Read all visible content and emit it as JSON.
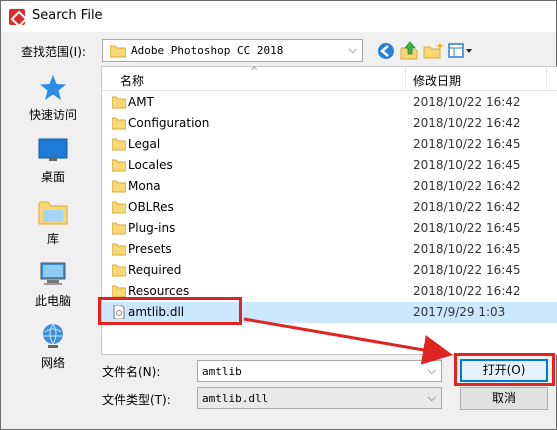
{
  "window": {
    "title": "Search File"
  },
  "lookin": {
    "label": "查找范围(I):",
    "value": "Adobe Photoshop CC 2018"
  },
  "places": [
    {
      "label": "快速访问",
      "icon": "star-icon"
    },
    {
      "label": "桌面",
      "icon": "desktop-icon"
    },
    {
      "label": "库",
      "icon": "library-icon"
    },
    {
      "label": "此电脑",
      "icon": "computer-icon"
    },
    {
      "label": "网络",
      "icon": "network-icon"
    }
  ],
  "columns": {
    "name": "名称",
    "date": "修改日期",
    "more": ""
  },
  "files": [
    {
      "name": "AMT",
      "date": "2018/10/22 16:42",
      "type": "folder"
    },
    {
      "name": "Configuration",
      "date": "2018/10/22 16:42",
      "type": "folder"
    },
    {
      "name": "Legal",
      "date": "2018/10/22 16:45",
      "type": "folder"
    },
    {
      "name": "Locales",
      "date": "2018/10/22 16:45",
      "type": "folder"
    },
    {
      "name": "Mona",
      "date": "2018/10/22 16:42",
      "type": "folder"
    },
    {
      "name": "OBLRes",
      "date": "2018/10/22 16:42",
      "type": "folder"
    },
    {
      "name": "Plug-ins",
      "date": "2018/10/22 16:45",
      "type": "folder"
    },
    {
      "name": "Presets",
      "date": "2018/10/22 16:45",
      "type": "folder"
    },
    {
      "name": "Required",
      "date": "2018/10/22 16:45",
      "type": "folder"
    },
    {
      "name": "Resources",
      "date": "2018/10/22 16:42",
      "type": "folder"
    },
    {
      "name": "amtlib.dll",
      "date": "2017/9/29 1:03",
      "type": "file"
    }
  ],
  "filename": {
    "label": "文件名(N):",
    "value": "amtlib"
  },
  "filetype": {
    "label": "文件类型(T):",
    "value": "amtlib.dll"
  },
  "buttons": {
    "open": "打开(O)",
    "cancel": "取消"
  },
  "colors": {
    "highlight": "#e02424",
    "selected_row": "#cce8ff",
    "accent": "#0078d7",
    "folder": "#f8d775"
  }
}
